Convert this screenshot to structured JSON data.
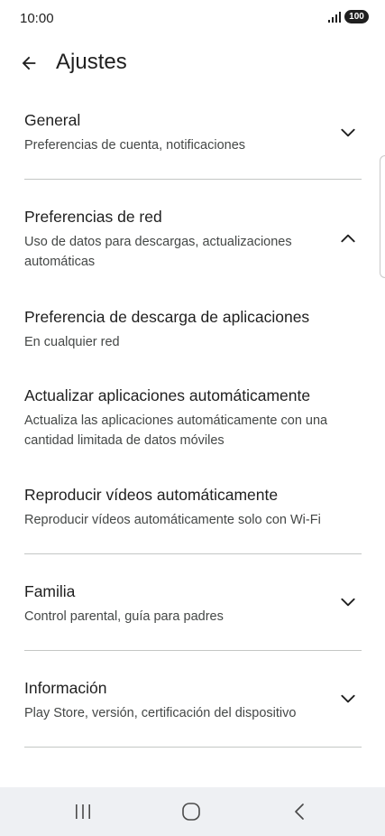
{
  "status_bar": {
    "time": "10:00",
    "battery": "100",
    "icons": [
      "signal-icon",
      "battery-icon"
    ]
  },
  "header": {
    "title": "Ajustes",
    "back_icon": "arrow-left-icon"
  },
  "sections": [
    {
      "title": "General",
      "subtitle": "Preferencias de cuenta, notificaciones",
      "expanded": false
    },
    {
      "title": "Preferencias de red",
      "subtitle": "Uso de datos para descargas, actualizaciones automáticas",
      "expanded": true
    },
    {
      "title": "Familia",
      "subtitle": "Control parental, guía para padres",
      "expanded": false
    },
    {
      "title": "Información",
      "subtitle": "Play Store, versión, certificación del dispositivo",
      "expanded": false
    }
  ],
  "network_items": [
    {
      "title": "Preferencia de descarga de aplicaciones",
      "subtitle": "En cualquier red"
    },
    {
      "title": "Actualizar aplicaciones automáticamente",
      "subtitle": "Actualiza las aplicaciones automáticamente con una cantidad limitada de datos móviles"
    },
    {
      "title": "Reproducir vídeos automáticamente",
      "subtitle": "Reproducir vídeos automáticamente solo con Wi-Fi"
    }
  ],
  "nav_bar": {
    "icons": [
      "recent-apps-icon",
      "home-icon",
      "back-icon"
    ]
  },
  "colors": {
    "text_primary": "#1f1f1f",
    "text_secondary": "#444746",
    "divider": "#c4c7c5",
    "nav_background": "#eef0f3"
  }
}
